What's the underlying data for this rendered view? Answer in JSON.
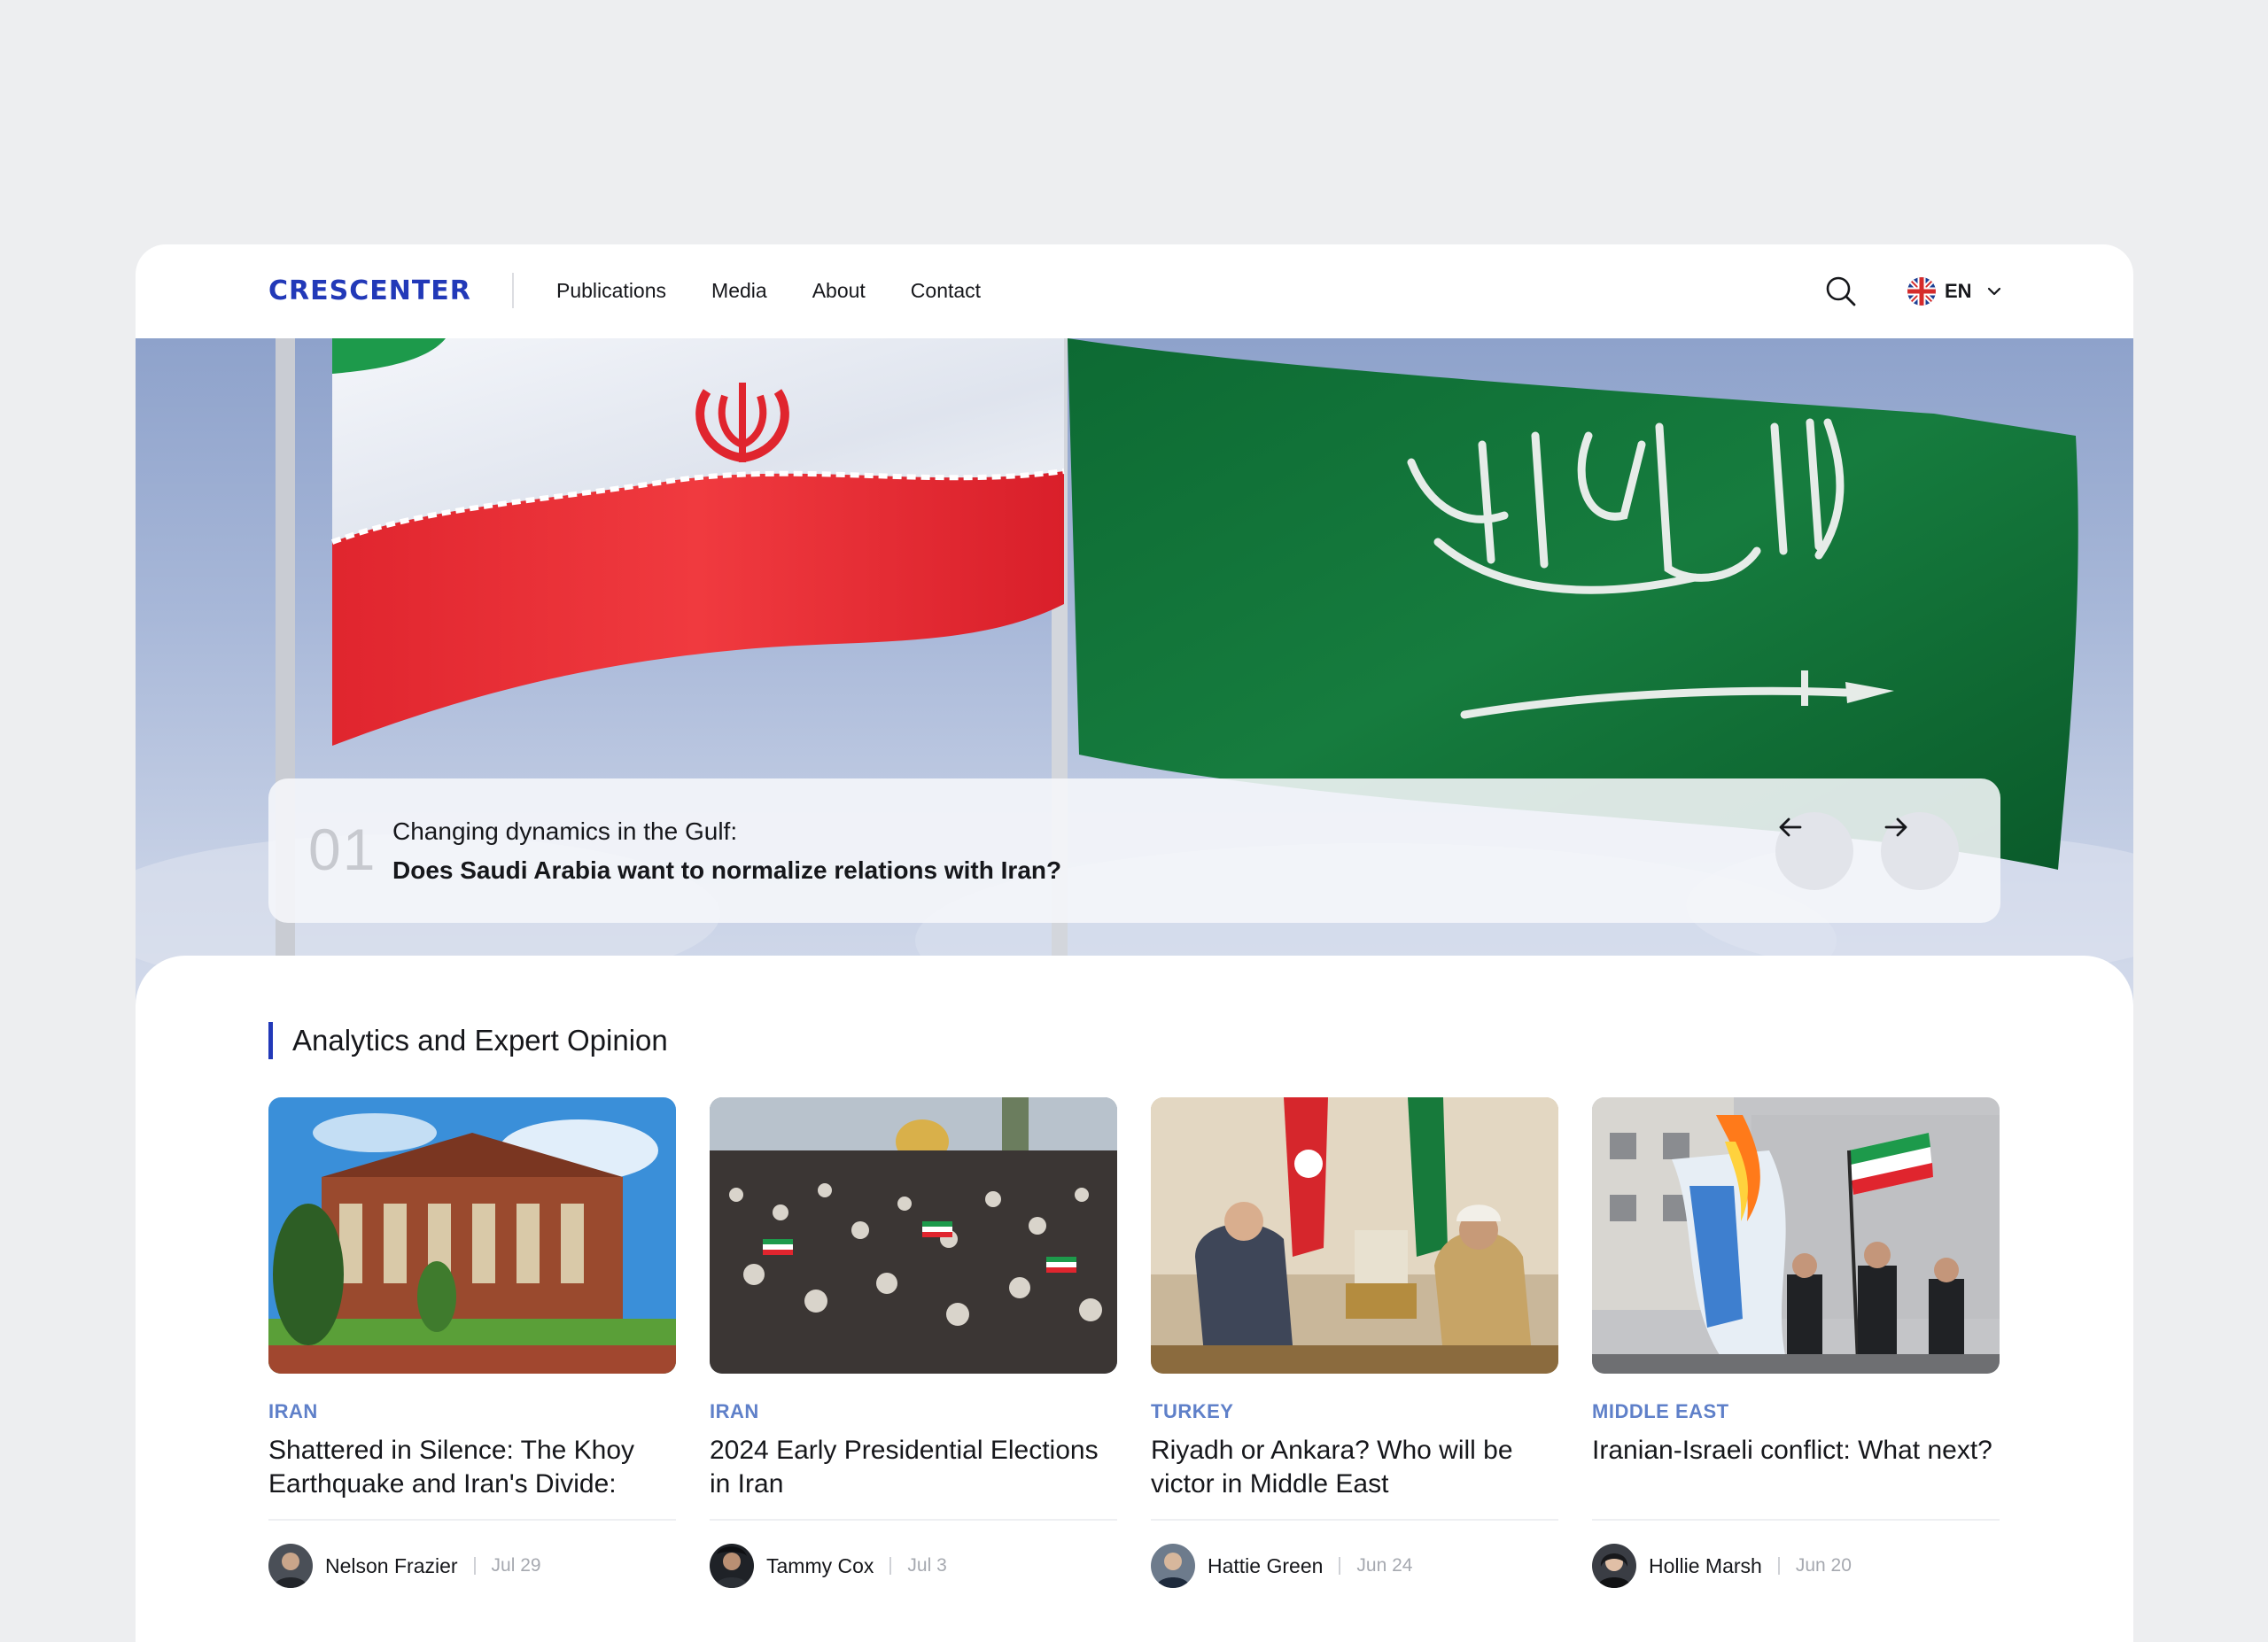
{
  "header": {
    "logo": "CRESCENTER",
    "nav": [
      "Publications",
      "Media",
      "About",
      "Contact"
    ],
    "language": "EN"
  },
  "hero": {
    "slide_number": "01",
    "kicker": "Changing dynamics in the Gulf:",
    "headline": "Does Saudi Arabia want to normalize relations with Iran?"
  },
  "section": {
    "title": "Analytics and Expert Opinion"
  },
  "articles": [
    {
      "tag": "IRAN",
      "title": "Shattered in Silence: The Khoy Earthquake and Iran's Divide:",
      "author": "Nelson Frazier",
      "date": "Jul 29"
    },
    {
      "tag": "IRAN",
      "title": "2024 Early Presidential Elections in Iran",
      "author": "Tammy Cox",
      "date": "Jul 3"
    },
    {
      "tag": "TURKEY",
      "title": "Riyadh or Ankara? Who will be victor in Middle East",
      "author": "Hattie Green",
      "date": "Jun 24"
    },
    {
      "tag": "MIDDLE EAST",
      "title": "Iranian-Israeli conflict: What next?",
      "author": "Hollie Marsh",
      "date": "Jun 20"
    }
  ],
  "colors": {
    "brand": "#2239b8",
    "tag": "#5f80c9",
    "background": "#edeef0"
  },
  "icons": [
    "search-icon",
    "uk-flag-icon",
    "chevron-down-icon",
    "arrow-left-icon",
    "arrow-right-icon"
  ]
}
